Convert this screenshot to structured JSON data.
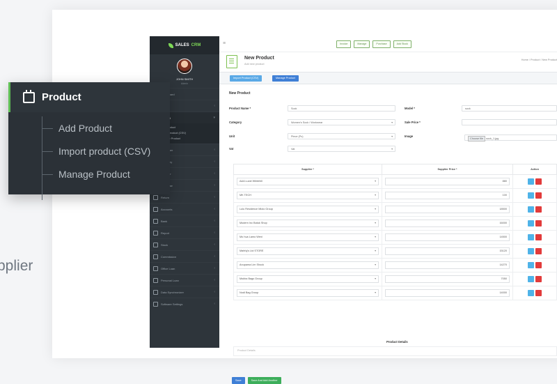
{
  "sidebar": {
    "logo_prefix": "SALES",
    "logo_suffix": "CRM",
    "user_name": "JOHN SMITH",
    "user_role": "Admin",
    "items": [
      {
        "label": "Dashboard"
      },
      {
        "label": "Invoice"
      },
      {
        "label": "Product"
      },
      {
        "label": "Customer"
      },
      {
        "label": "Category"
      },
      {
        "label": "Supplier"
      },
      {
        "label": "Purchase"
      },
      {
        "label": "Return"
      },
      {
        "label": "Accounts"
      },
      {
        "label": "Bank"
      },
      {
        "label": "Report"
      },
      {
        "label": "Stock"
      },
      {
        "label": "Commission"
      },
      {
        "label": "Office Loan"
      },
      {
        "label": "Personal Loan"
      },
      {
        "label": "Data Synchronizer"
      },
      {
        "label": "Software Settings"
      }
    ],
    "submenu": [
      "Add Product",
      "Import product (CSV)",
      "Manage Product"
    ]
  },
  "topbar": {
    "buttons": [
      "Invoice",
      "Manage",
      "Purchase",
      "Add Stock"
    ]
  },
  "header": {
    "title": "New Product",
    "subtitle": "Add new product",
    "breadcrumb": "Home  /  Product  /  New Product"
  },
  "actions": {
    "import": "Import Product (CSV)",
    "manage": "Manage Product"
  },
  "form": {
    "panel_title": "New Product",
    "product_name_label": "Product Name *",
    "product_name_value": "Sock",
    "category_label": "Category",
    "category_value": "Women's Sock / Workwear",
    "unit_label": "Unit",
    "unit_value": "Piece (Pc)",
    "vat_label": "Vat",
    "vat_value": "Vat",
    "model_label": "Model *",
    "model_value": "sock",
    "sale_price_label": "Sale Price *",
    "sale_price_value": "",
    "image_label": "Image",
    "choose_file": "Choose file",
    "file_name": "sock_1.jpg"
  },
  "suppliers_table": {
    "headers": [
      "Supplier *",
      "Supplier Price *",
      "Action"
    ],
    "rows": [
      {
        "supplier": "A&A Lucid Whitehill",
        "price": "880"
      },
      {
        "supplier": "MK TECH",
        "price": "100"
      },
      {
        "supplier": "Lulu Residence Mlolo Group",
        "price": "18500"
      },
      {
        "supplier": "Modern Inc Batuk Shop",
        "price": "16000"
      },
      {
        "supplier": "Mo hua Lamo Weni",
        "price": "14500"
      },
      {
        "supplier": "Mahfuj's Ltd STORE",
        "price": "15120"
      },
      {
        "supplier": "Anupama Lim Shock",
        "price": "14270"
      },
      {
        "supplier": "Mokha Bags Group",
        "price": "7050"
      },
      {
        "supplier": "Nodi Bag Group",
        "price": "14000"
      }
    ]
  },
  "product_details": {
    "label": "Product Details",
    "placeholder": "Product Details"
  },
  "bottom_buttons": {
    "save": "Save",
    "save_another": "Save And Add Another"
  },
  "callout": {
    "title": "Product",
    "items": [
      "Add Product",
      "Import product (CSV)",
      "Manage Product"
    ]
  },
  "background_text": "pplier",
  "colors": {
    "sidebar_bg": "#2e353b",
    "accent_green": "#5fbf55",
    "primary_blue": "#3f7fd6",
    "danger_red": "#e23b3b"
  }
}
